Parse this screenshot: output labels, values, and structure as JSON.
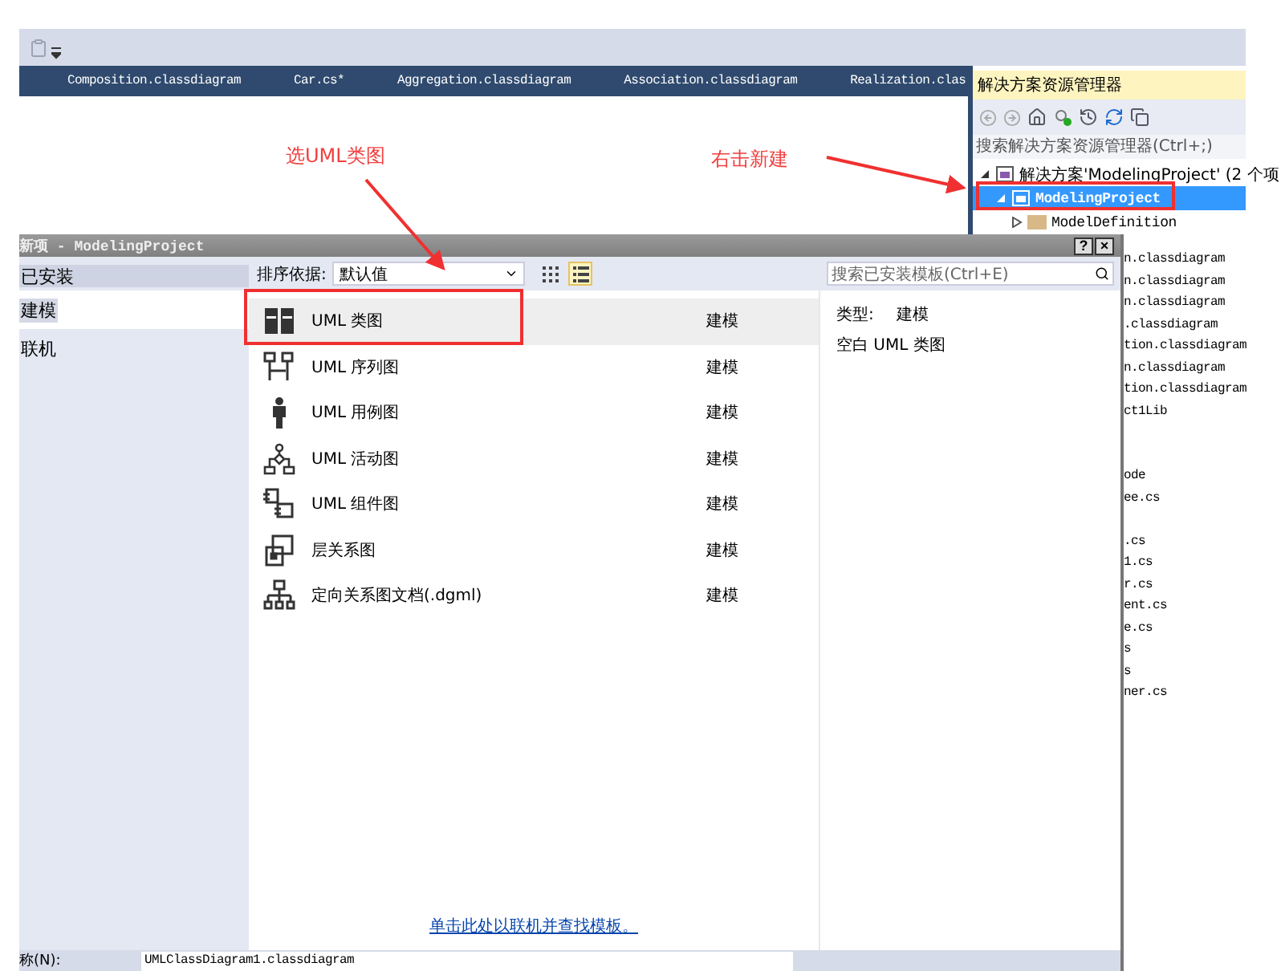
{
  "ide": {
    "tabs": [
      {
        "label": "Composition.classdiagram",
        "selected": false
      },
      {
        "label": "Car.cs*",
        "selected": false
      },
      {
        "label": "Aggregation.classdiagram",
        "selected": false
      },
      {
        "label": "Association.classdiagram",
        "selected": false
      },
      {
        "label": "Realization.clas",
        "selected": false
      }
    ]
  },
  "solution_explorer": {
    "title": "解决方案资源管理器",
    "search": {
      "placeholder": "搜索解决方案资源管理器(Ctrl+;)"
    },
    "tree": [
      {
        "label": "解决方案'ModelingProject' (2 个项",
        "selected": false,
        "expanded": true,
        "children": [
          {
            "label": "ModelingProject",
            "selected": true,
            "expanded": true,
            "children": [
              {
                "label": "ModelDefinition",
                "selected": false,
                "expanded": false
              }
            ]
          }
        ]
      }
    ],
    "files": [
      {
        "kind": "file",
        "label": "n.classdiagram"
      },
      {
        "kind": "file",
        "label": "n.classdiagram"
      },
      {
        "kind": "file",
        "label": "n.classdiagram"
      },
      {
        "kind": "file",
        "label": ".classdiagram"
      },
      {
        "kind": "file",
        "label": "tion.classdiagram"
      },
      {
        "kind": "file",
        "label": "n.classdiagram"
      },
      {
        "kind": "file",
        "label": "tion.classdiagram"
      },
      {
        "kind": "file",
        "label": "ct1Lib"
      },
      {
        "kind": "gap"
      },
      {
        "kind": "gap"
      },
      {
        "kind": "file",
        "label": "ode"
      },
      {
        "kind": "file",
        "label": "ee.cs"
      },
      {
        "kind": "gap"
      },
      {
        "kind": "file",
        "label": ".cs"
      },
      {
        "kind": "file",
        "label": "1.cs"
      },
      {
        "kind": "file",
        "label": "r.cs"
      },
      {
        "kind": "file",
        "label": "ent.cs"
      },
      {
        "kind": "file",
        "label": "e.cs"
      },
      {
        "kind": "file",
        "label": "s"
      },
      {
        "kind": "file",
        "label": "s"
      },
      {
        "kind": "file",
        "label": "ner.cs"
      }
    ]
  },
  "dialog": {
    "title": "新项 - ModelingProject",
    "help": "?",
    "close": "×",
    "categories": [
      {
        "kind": "header",
        "label": "已安装",
        "selected": false
      },
      {
        "kind": "item",
        "label": "建模",
        "selected": true
      },
      {
        "kind": "item",
        "label": "联机",
        "selected": false
      }
    ],
    "sort": {
      "label": "排序依据:",
      "value": "默认值"
    },
    "views": [
      {
        "kind": "grid",
        "selected": false
      },
      {
        "kind": "list",
        "selected": true
      }
    ],
    "templates": [
      {
        "kind": "class",
        "name": "UML 类图",
        "category": "建模",
        "selected": true
      },
      {
        "kind": "sequence",
        "name": "UML 序列图",
        "category": "建模",
        "selected": false
      },
      {
        "kind": "usecase",
        "name": "UML 用例图",
        "category": "建模",
        "selected": false
      },
      {
        "kind": "activity",
        "name": "UML 活动图",
        "category": "建模",
        "selected": false
      },
      {
        "kind": "component",
        "name": "UML 组件图",
        "category": "建模",
        "selected": false
      },
      {
        "kind": "layer",
        "name": "层关系图",
        "category": "建模",
        "selected": false
      },
      {
        "kind": "dgml",
        "name": "定向关系图文档(.dgml)",
        "category": "建模",
        "selected": false
      }
    ],
    "online_link": "单击此处以联机并查找模板。",
    "search": {
      "placeholder": "搜索已安装模板(Ctrl+E)"
    },
    "details": {
      "type_label": "类型:",
      "type_value": "建模",
      "description": "空白 UML 类图"
    },
    "name_field": {
      "label": "称(N):",
      "value": "UMLClassDiagram1.classdiagram"
    }
  },
  "annotations": [
    {
      "text": "选UML类图"
    },
    {
      "text": "右击新建"
    }
  ]
}
